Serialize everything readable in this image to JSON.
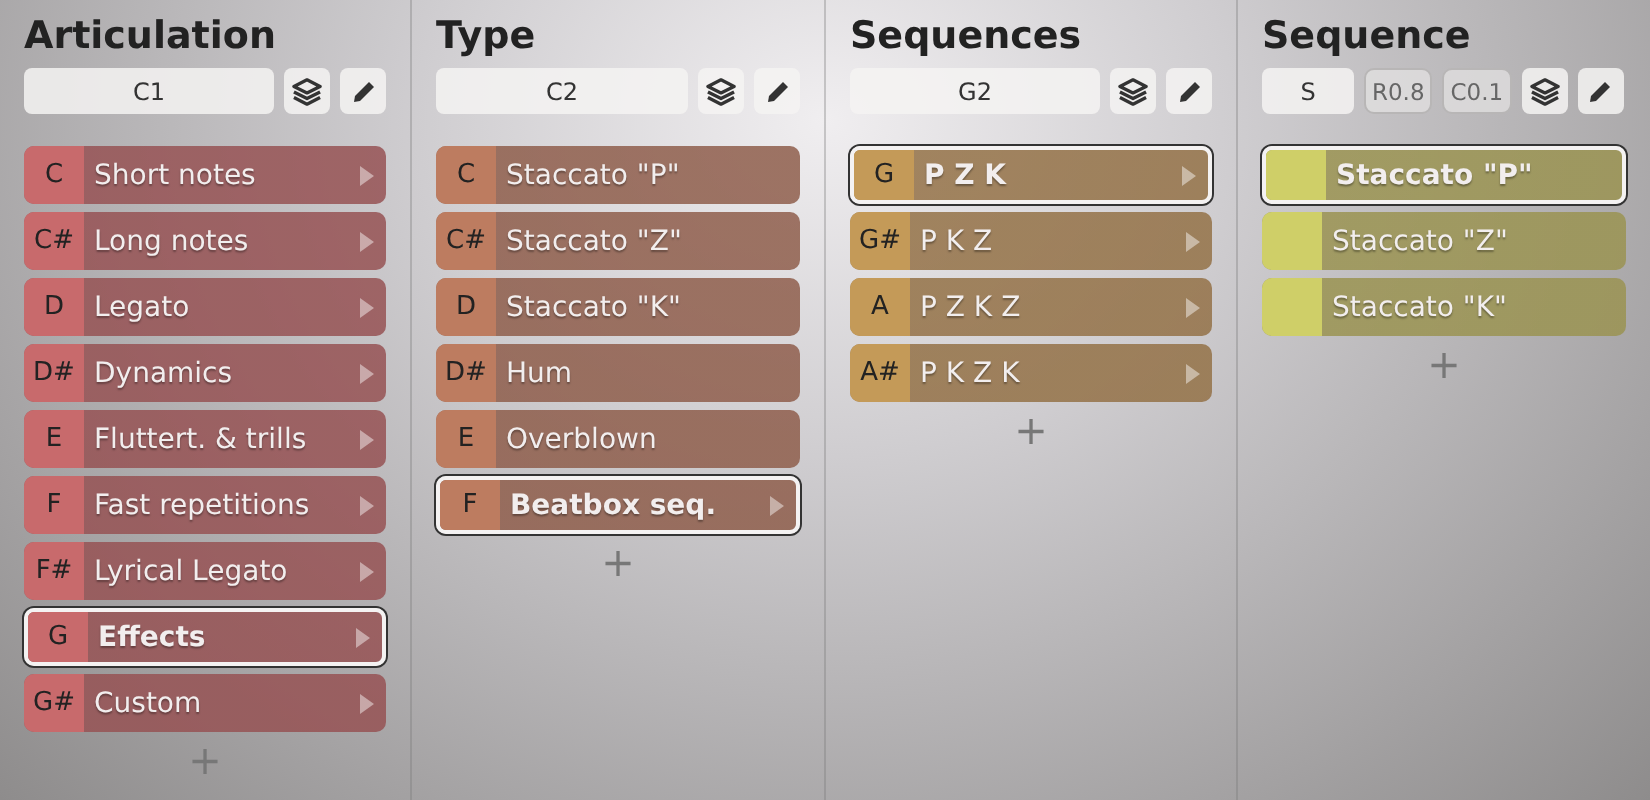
{
  "columns": [
    {
      "title": "Articulation",
      "color": "#c86a6c",
      "field": {
        "value": "C1"
      },
      "items": [
        {
          "key": "C",
          "label": "Short notes",
          "expandable": true,
          "selected": false
        },
        {
          "key": "C#",
          "label": "Long notes",
          "expandable": true,
          "selected": false
        },
        {
          "key": "D",
          "label": "Legato",
          "expandable": true,
          "selected": false
        },
        {
          "key": "D#",
          "label": "Dynamics",
          "expandable": true,
          "selected": false
        },
        {
          "key": "E",
          "label": "Fluttert. & trills",
          "expandable": true,
          "selected": false
        },
        {
          "key": "F",
          "label": "Fast repetitions",
          "expandable": true,
          "selected": false
        },
        {
          "key": "F#",
          "label": "Lyrical Legato",
          "expandable": true,
          "selected": false
        },
        {
          "key": "G",
          "label": "Effects",
          "expandable": true,
          "selected": true
        },
        {
          "key": "G#",
          "label": "Custom",
          "expandable": true,
          "selected": false
        }
      ],
      "add": "+"
    },
    {
      "title": "Type",
      "color": "#bd7c60",
      "field": {
        "value": "C2"
      },
      "items": [
        {
          "key": "C",
          "label": "Staccato \"P\"",
          "expandable": false,
          "selected": false
        },
        {
          "key": "C#",
          "label": "Staccato \"Z\"",
          "expandable": false,
          "selected": false
        },
        {
          "key": "D",
          "label": "Staccato \"K\"",
          "expandable": false,
          "selected": false
        },
        {
          "key": "D#",
          "label": "Hum",
          "expandable": false,
          "selected": false
        },
        {
          "key": "E",
          "label": "Overblown",
          "expandable": false,
          "selected": false
        },
        {
          "key": "F",
          "label": "Beatbox seq.",
          "expandable": true,
          "selected": true
        }
      ],
      "add": "+"
    },
    {
      "title": "Sequences",
      "color": "#c49a58",
      "field": {
        "value": "G2"
      },
      "items": [
        {
          "key": "G",
          "label": "P Z K",
          "expandable": true,
          "selected": true
        },
        {
          "key": "G#",
          "label": "P K Z",
          "expandable": true,
          "selected": false
        },
        {
          "key": "A",
          "label": "P Z K Z",
          "expandable": true,
          "selected": false
        },
        {
          "key": "A#",
          "label": "P K Z K",
          "expandable": true,
          "selected": false
        }
      ],
      "add": "+"
    },
    {
      "title": "Sequence",
      "color": "#cfcf68",
      "field": {
        "value": "S"
      },
      "badges": [
        "R0.8",
        "C0.1"
      ],
      "items": [
        {
          "label": "Staccato \"P\"",
          "expandable": false,
          "selected": true
        },
        {
          "label": "Staccato \"Z\"",
          "expandable": false,
          "selected": false
        },
        {
          "label": "Staccato \"K\"",
          "expandable": false,
          "selected": false
        }
      ],
      "add": "+"
    }
  ]
}
